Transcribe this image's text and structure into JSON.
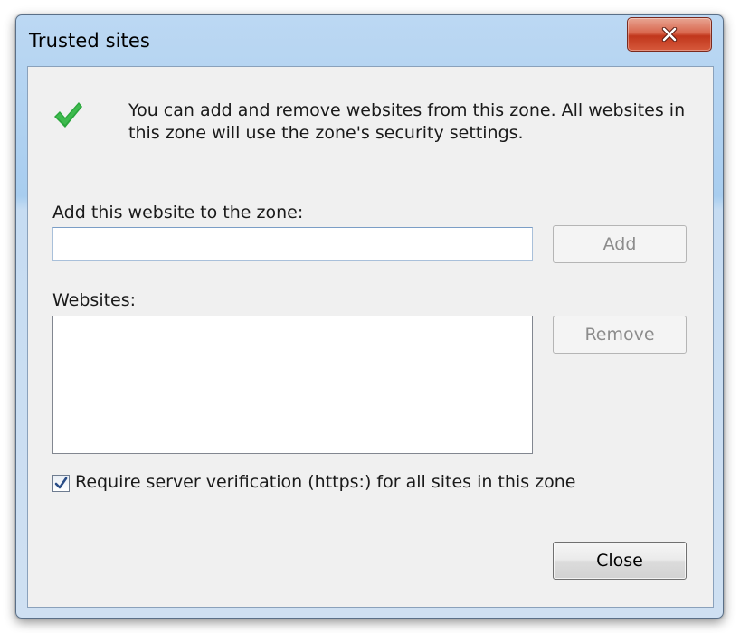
{
  "window": {
    "title": "Trusted sites"
  },
  "intro": {
    "text": "You can add and remove websites from this zone. All websites in this zone will use the zone's security settings."
  },
  "add_section": {
    "label": "Add this website to the zone:",
    "input_value": "",
    "add_button": "Add"
  },
  "websites_section": {
    "label": "Websites:",
    "items": [],
    "remove_button": "Remove"
  },
  "https_option": {
    "label": "Require server verification (https:) for all sites in this zone",
    "checked": true
  },
  "footer": {
    "close_button": "Close"
  },
  "colors": {
    "check_icon": "#2aa63c",
    "close_x_button": "#c7432a"
  }
}
